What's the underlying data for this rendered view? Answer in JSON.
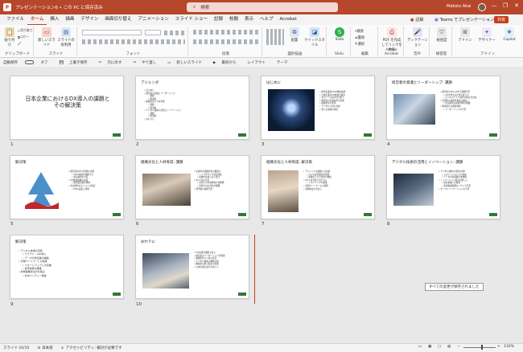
{
  "titlebar": {
    "filename": "プレゼンテーション6 • この PC に保存済み",
    "search_placeholder": "検索",
    "user": "Makoto Akai",
    "controls": [
      "—",
      "❐",
      "✕"
    ]
  },
  "tabs": [
    "ファイル",
    "ホーム",
    "挿入",
    "描画",
    "デザイン",
    "画面切り替え",
    "アニメーション",
    "スライド ショー",
    "記録",
    "校閲",
    "表示",
    "ヘルプ",
    "Acrobat"
  ],
  "tab_right": {
    "record": "記録",
    "teams": "Teams でプレゼンテーション",
    "share": "共有"
  },
  "ribbon": {
    "groups": [
      "クリップボード",
      "スライド",
      "フォント",
      "段落",
      "図形描画",
      "Slido",
      "編集",
      "Adobe Acrobat",
      "音声",
      "秘密度",
      "アドイン"
    ],
    "buttons": {
      "paste": "貼り付け",
      "new_slide": "新しいスライド",
      "reuse_slide": "スライドの再利用",
      "arrange": "配置",
      "quick_styles": "クイックスタイル",
      "slido": "Slido",
      "find": "検索",
      "replace": "置換",
      "select": "選択",
      "pdf_share": "PDF を作成してリンクを共有",
      "dictate": "ディクテーション",
      "sensitivity": "秘密度",
      "addins": "アドイン",
      "designer": "デザイナー",
      "copilot": "Copilot",
      "cut": "切り取り",
      "copy": "コピー",
      "format_copy": "書式のコピー/貼り付け"
    }
  },
  "qat": {
    "autosave": "自動保存",
    "autosave_state": "オフ",
    "overwrite": "上書き保存",
    "undo": "元に戻す",
    "redo": "やり直し",
    "new_slide": "新しいスライド",
    "from_start": "最初から",
    "layout": "レイアウト",
    "theme": "テーマ"
  },
  "slides": [
    {
      "num": "1",
      "title": "日本企業におけるDX導入の課題とその解決策",
      "bullets": []
    },
    {
      "num": "2",
      "title": "アジェンダ",
      "bullets": [
        "はじめに",
        "経営者の意識とリーダーシップ",
        "課題",
        "解決策",
        "組織文化と人材育成",
        "課題",
        "解決策",
        "デジタル技術の活用とイノベーション",
        "課題",
        "解決策",
        "おわりに"
      ]
    },
    {
      "num": "3",
      "title": "はじめに",
      "bullets": [
        "経済産業省のDX推進指標",
        "日本企業のDX推進の遅れ",
        "グローバル競争力の低下",
        "経営者の意識改革が必要",
        "組織文化の変革",
        "デジタル人材の育成",
        "新たな価値の創出"
      ]
    },
    {
      "num": "4",
      "title": "経営者の意識とリーダーシップ: 課題",
      "bullets": [
        "経営者のDXに対する理解不足",
        "DXを単なるIT化と捉える",
        "ビジネスモデル変革の視点が欠如",
        "短期的な成果を求める傾向",
        "中長期的な投資判断が困難",
        "現場任せの推進体制",
        "リーダーシップの不足"
      ]
    },
    {
      "num": "5",
      "title": "解決策",
      "bullets": [
        "経営者向けDX研修の実施",
        "DXの本質を理解する",
        "成功事例の共有",
        "DX推進組織の設置",
        "経営層直轄の体制",
        "中長期的なビジョンの策定",
        "KPIの設定と評価"
      ]
    },
    {
      "num": "6",
      "title": "組織文化と人材育成: 課題",
      "bullets": [
        "伝統的な組織文化の根強さ",
        "トップダウンの意思決定",
        "失敗を許容しない風土",
        "DX人材の不足",
        "社内での育成体制が未整備",
        "外部人材の活用が困難",
        "部門間の連携不足"
      ]
    },
    {
      "num": "7",
      "title": "組織文化と人材育成: 解決策",
      "bullets": [
        "アジャイルな組織への転換",
        "小さな試行錯誤を推奨",
        "失敗から学ぶ文化の醸成",
        "DX人材育成プログラム",
        "リスキリングの推進",
        "外部パートナーとの連携",
        "評価制度の見直し"
      ]
    },
    {
      "num": "8",
      "title": "デジタル技術の活用とイノベーション: 課題",
      "bullets": [
        "デジタル技術の活用の遅れ",
        "レガシーシステムの存在",
        "データ活用基盤の未整備",
        "イノベーション創出の難しさ",
        "既存事業への依存",
        "新規事業開発のノウハウ不足",
        "オープンイノベーションの不足"
      ]
    },
    {
      "num": "9",
      "title": "解決策",
      "bullets": [
        "デジタル技術の活用",
        "クラウド・AIの導入",
        "データ分析基盤の構築",
        "外部パートナーとの連携",
        "スタートアップとの協業",
        "産学連携の推進",
        "新規事業創出の仕組み",
        "社内ベンチャー制度"
      ]
    },
    {
      "num": "10",
      "title": "おわりに",
      "bullets": [
        "DXは経営課題である",
        "経営者のリーダーシップが重要",
        "組織文化と人材の変革",
        "デジタル技術の積極活用",
        "継続的な取り組みが必要",
        "日本企業の競争力向上へ"
      ]
    }
  ],
  "tooltip": "すべての変更が保存されました",
  "statusbar": {
    "slide_count": "スライド 10/10",
    "language": "日本語",
    "accessibility": "アクセシビリティ: 検討が必要です",
    "zoom": "110%"
  }
}
